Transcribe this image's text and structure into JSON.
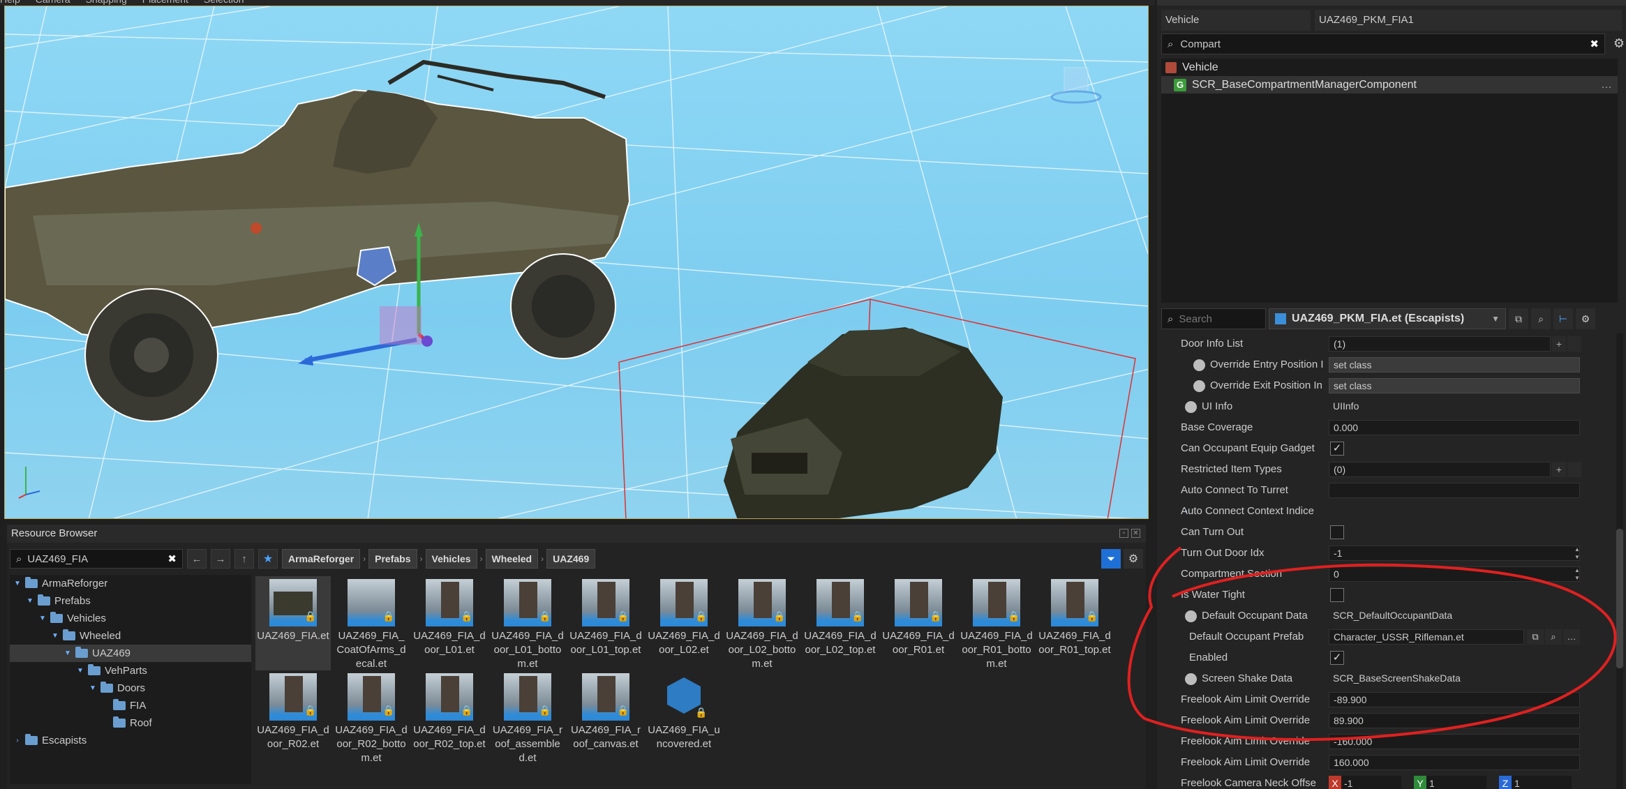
{
  "menu": {
    "items": [
      "Help",
      "Camera",
      "Snapping",
      "Placement",
      "Selection"
    ]
  },
  "viewport": {
    "bg": "#8fd8f5",
    "accent_red": "#e03030"
  },
  "resource_browser": {
    "title": "Resource Browser",
    "search_value": "UAZ469_FIA",
    "breadcrumb": [
      "ArmaReforger",
      "Prefabs",
      "Vehicles",
      "Wheeled",
      "UAZ469"
    ],
    "tree": [
      {
        "label": "ArmaReforger",
        "depth": 0,
        "expanded": true
      },
      {
        "label": "Prefabs",
        "depth": 1,
        "expanded": true
      },
      {
        "label": "Vehicles",
        "depth": 2,
        "expanded": true
      },
      {
        "label": "Wheeled",
        "depth": 3,
        "expanded": true
      },
      {
        "label": "UAZ469",
        "depth": 4,
        "expanded": true,
        "selected": true
      },
      {
        "label": "VehParts",
        "depth": 5,
        "expanded": true
      },
      {
        "label": "Doors",
        "depth": 6,
        "expanded": true
      },
      {
        "label": "FIA",
        "depth": 7,
        "expanded": false
      },
      {
        "label": "Roof",
        "depth": 7,
        "expanded": false
      },
      {
        "label": "Escapists",
        "depth": 0,
        "expanded": false
      }
    ],
    "files_row1": [
      "UAZ469_FIA.et",
      "UAZ469_FIA_CoatOfArms_decal.et",
      "UAZ469_FIA_door_L01.et",
      "UAZ469_FIA_door_L01_bottom.et",
      "UAZ469_FIA_door_L01_top.et",
      "UAZ469_FIA_door_L02.et",
      "UAZ469_FIA_door_L02_bottom.et",
      "UAZ469_FIA_door_L02_top.et",
      "UAZ469_FIA_door_R01.et",
      "UAZ469_FIA_door_R01_bottom.et",
      "UAZ469_FIA_door_R01_top.et"
    ],
    "files_row2": [
      "UAZ469_FIA_door_R02.et",
      "UAZ469_FIA_door_R02_bottom.et",
      "UAZ469_FIA_door_R02_top.et",
      "UAZ469_FIA_roof_assembled.et",
      "UAZ469_FIA_roof_canvas.et",
      "UAZ469_FIA_uncovered.et"
    ]
  },
  "object_properties": {
    "type_label": "Vehicle",
    "name_value": "UAZ469_PKM_FIA1",
    "component_search": "Compart",
    "components": [
      {
        "label": "Vehicle",
        "icon": "cube-icon"
      },
      {
        "label": "SCR_BaseCompartmentManagerComponent",
        "icon": "component-g-icon",
        "selected": true
      }
    ],
    "prop_search_placeholder": "Search",
    "prefab_file": "UAZ469_PKM_FIA.et (Escapists)"
  },
  "properties": [
    {
      "name": "Door Info List",
      "value": "(1)",
      "kind": "list",
      "indent": 1
    },
    {
      "name": "Override Entry Position I",
      "value": "set class",
      "kind": "button",
      "indent": 2,
      "radio": true
    },
    {
      "name": "Override Exit Position In",
      "value": "set class",
      "kind": "button",
      "indent": 2,
      "radio": true
    },
    {
      "name": "UI Info",
      "value": "UIInfo",
      "kind": "plain",
      "indent": 1,
      "radio": true,
      "arrow": true
    },
    {
      "name": "Base Coverage",
      "value": "0.000",
      "kind": "field",
      "indent": 0
    },
    {
      "name": "Can Occupant Equip Gadget",
      "value": "✓",
      "kind": "check",
      "indent": 0
    },
    {
      "name": "Restricted Item Types",
      "value": "(0)",
      "kind": "list",
      "indent": 0
    },
    {
      "name": "Auto Connect To Turret",
      "value": "",
      "kind": "field",
      "indent": 0
    },
    {
      "name": "Auto Connect Context Indice",
      "value": "",
      "kind": "none",
      "indent": 1,
      "arrow": true
    },
    {
      "name": "Can Turn Out",
      "value": "",
      "kind": "check",
      "indent": 0
    },
    {
      "name": "Turn Out Door Idx",
      "value": "-1",
      "kind": "spin",
      "indent": 0
    },
    {
      "name": "Compartment Section",
      "value": "0",
      "kind": "spin",
      "indent": 0
    },
    {
      "name": "Is Water Tight",
      "value": "",
      "kind": "check",
      "indent": 0
    },
    {
      "name": "Default Occupant Data",
      "value": "SCR_DefaultOccupantData",
      "kind": "plain",
      "indent": 1,
      "radio": true,
      "arrow": true,
      "expanded": true
    },
    {
      "name": "Default Occupant Prefab",
      "value": "Character_USSR_Rifleman.et",
      "kind": "resource",
      "indent": 2
    },
    {
      "name": "Enabled",
      "value": "✓",
      "kind": "check",
      "indent": 2
    },
    {
      "name": "Screen Shake Data",
      "value": "SCR_BaseScreenShakeData",
      "kind": "plain",
      "indent": 1,
      "radio": true,
      "arrow": true
    },
    {
      "name": "Freelook Aim Limit Override",
      "value": "-89.900",
      "kind": "field",
      "indent": 0
    },
    {
      "name": "Freelook Aim Limit Override",
      "value": "89.900",
      "kind": "field",
      "indent": 0
    },
    {
      "name": "Freelook Aim Limit Override",
      "value": "-160.000",
      "kind": "field",
      "indent": 0
    },
    {
      "name": "Freelook Aim Limit Override",
      "value": "160.000",
      "kind": "field",
      "indent": 0
    },
    {
      "name": "Freelook Camera Neck Offse",
      "value": "",
      "kind": "vec",
      "indent": 0,
      "vec": [
        "-1",
        "1",
        "1"
      ]
    }
  ],
  "colors": {
    "accent_blue": "#1e6fd6",
    "annotation_red": "#e02020",
    "panel_bg": "#242424"
  }
}
